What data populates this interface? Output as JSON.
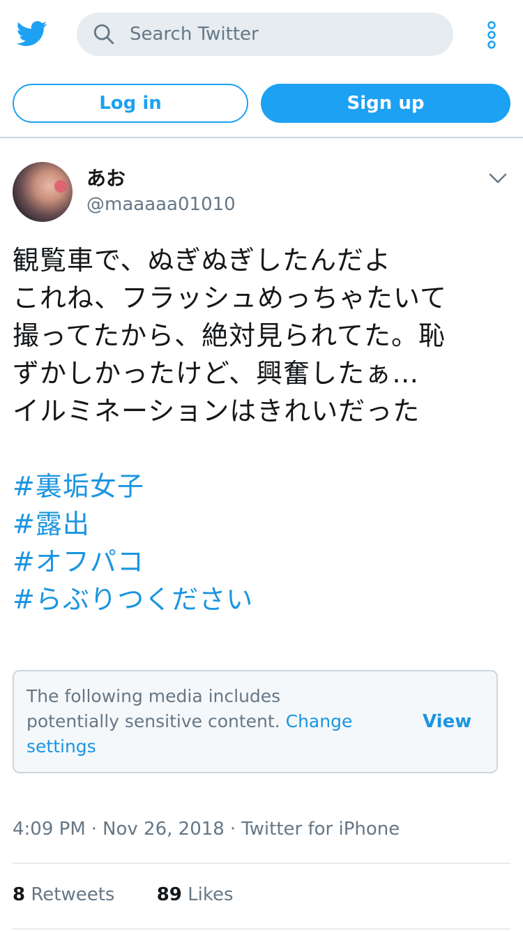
{
  "header": {
    "search_placeholder": "Search Twitter",
    "brand_color": "#1da1f2"
  },
  "auth": {
    "login_label": "Log in",
    "signup_label": "Sign up"
  },
  "tweet": {
    "author_name": "あお",
    "author_handle": "@maaaaa01010",
    "text": "観覧車で、ぬぎぬぎしたんだよ\nこれね、フラッシュめっちゃたいて\n撮ってたから、絶対見られてた。恥\nずかしかったけど、興奮したぁ…\nイルミネーションはきれいだった",
    "hashtags": [
      "#裏垢女子",
      "#露出",
      "#オフパコ",
      "#らぶりつください"
    ],
    "sensitive_notice": {
      "message": "The following media includes potentially sensitive content.",
      "link": "Change settings",
      "view_label": "View"
    },
    "time": "4:09 PM",
    "date": "Nov 26, 2018",
    "source": "Twitter for iPhone",
    "retweets_count": "8",
    "retweets_label": "Retweets",
    "likes_count": "89",
    "likes_label": "Likes"
  },
  "icons": {
    "logo": "twitter-bird-icon",
    "search": "search-icon",
    "more": "more-vertical-icon",
    "caret": "chevron-down-icon"
  }
}
